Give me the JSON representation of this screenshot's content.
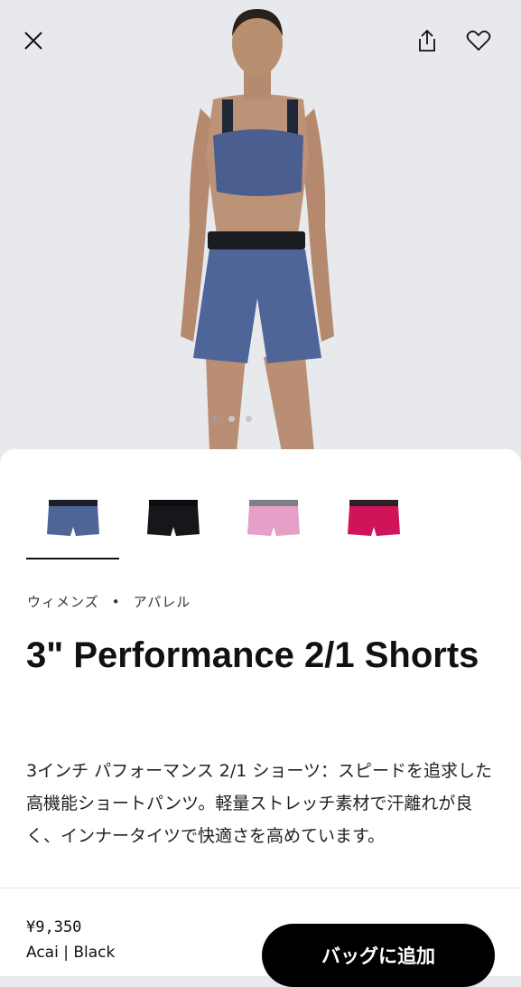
{
  "hero": {
    "image_alt": "Model wearing 3\" Performance 2/1 Shorts in Acai with matching sports bra",
    "carousel": {
      "count": 3,
      "active": 0
    }
  },
  "toolbar": {
    "close_icon": "close-icon",
    "share_icon": "share-icon",
    "favorite_icon": "heart-icon"
  },
  "swatches": [
    {
      "name": "Acai | Black",
      "short": "#4f6598",
      "band": "#1c1f2b",
      "selected": true
    },
    {
      "name": "Black",
      "short": "#15171a",
      "band": "#0c0d0f",
      "selected": false
    },
    {
      "name": "Pink",
      "short": "#e6a0c8",
      "band": "#7d7f88",
      "selected": false
    },
    {
      "name": "Magenta",
      "short": "#d0145a",
      "band": "#2a2224",
      "selected": false
    }
  ],
  "breadcrumb": {
    "category": "ウィメンズ",
    "separator": "•",
    "subcategory": "アパレル"
  },
  "product": {
    "title": "3\" Performance 2/1 Shorts",
    "description": "3インチ パフォーマンス 2/1 ショーツ：スピードを追求した高機能ショートパンツ。軽量ストレッチ素材で汗離れが良く、インナータイツで快適さを高めています。",
    "price": "¥9,350",
    "color": "Acai | Black"
  },
  "cta": {
    "add_to_bag": "バッグに追加"
  }
}
